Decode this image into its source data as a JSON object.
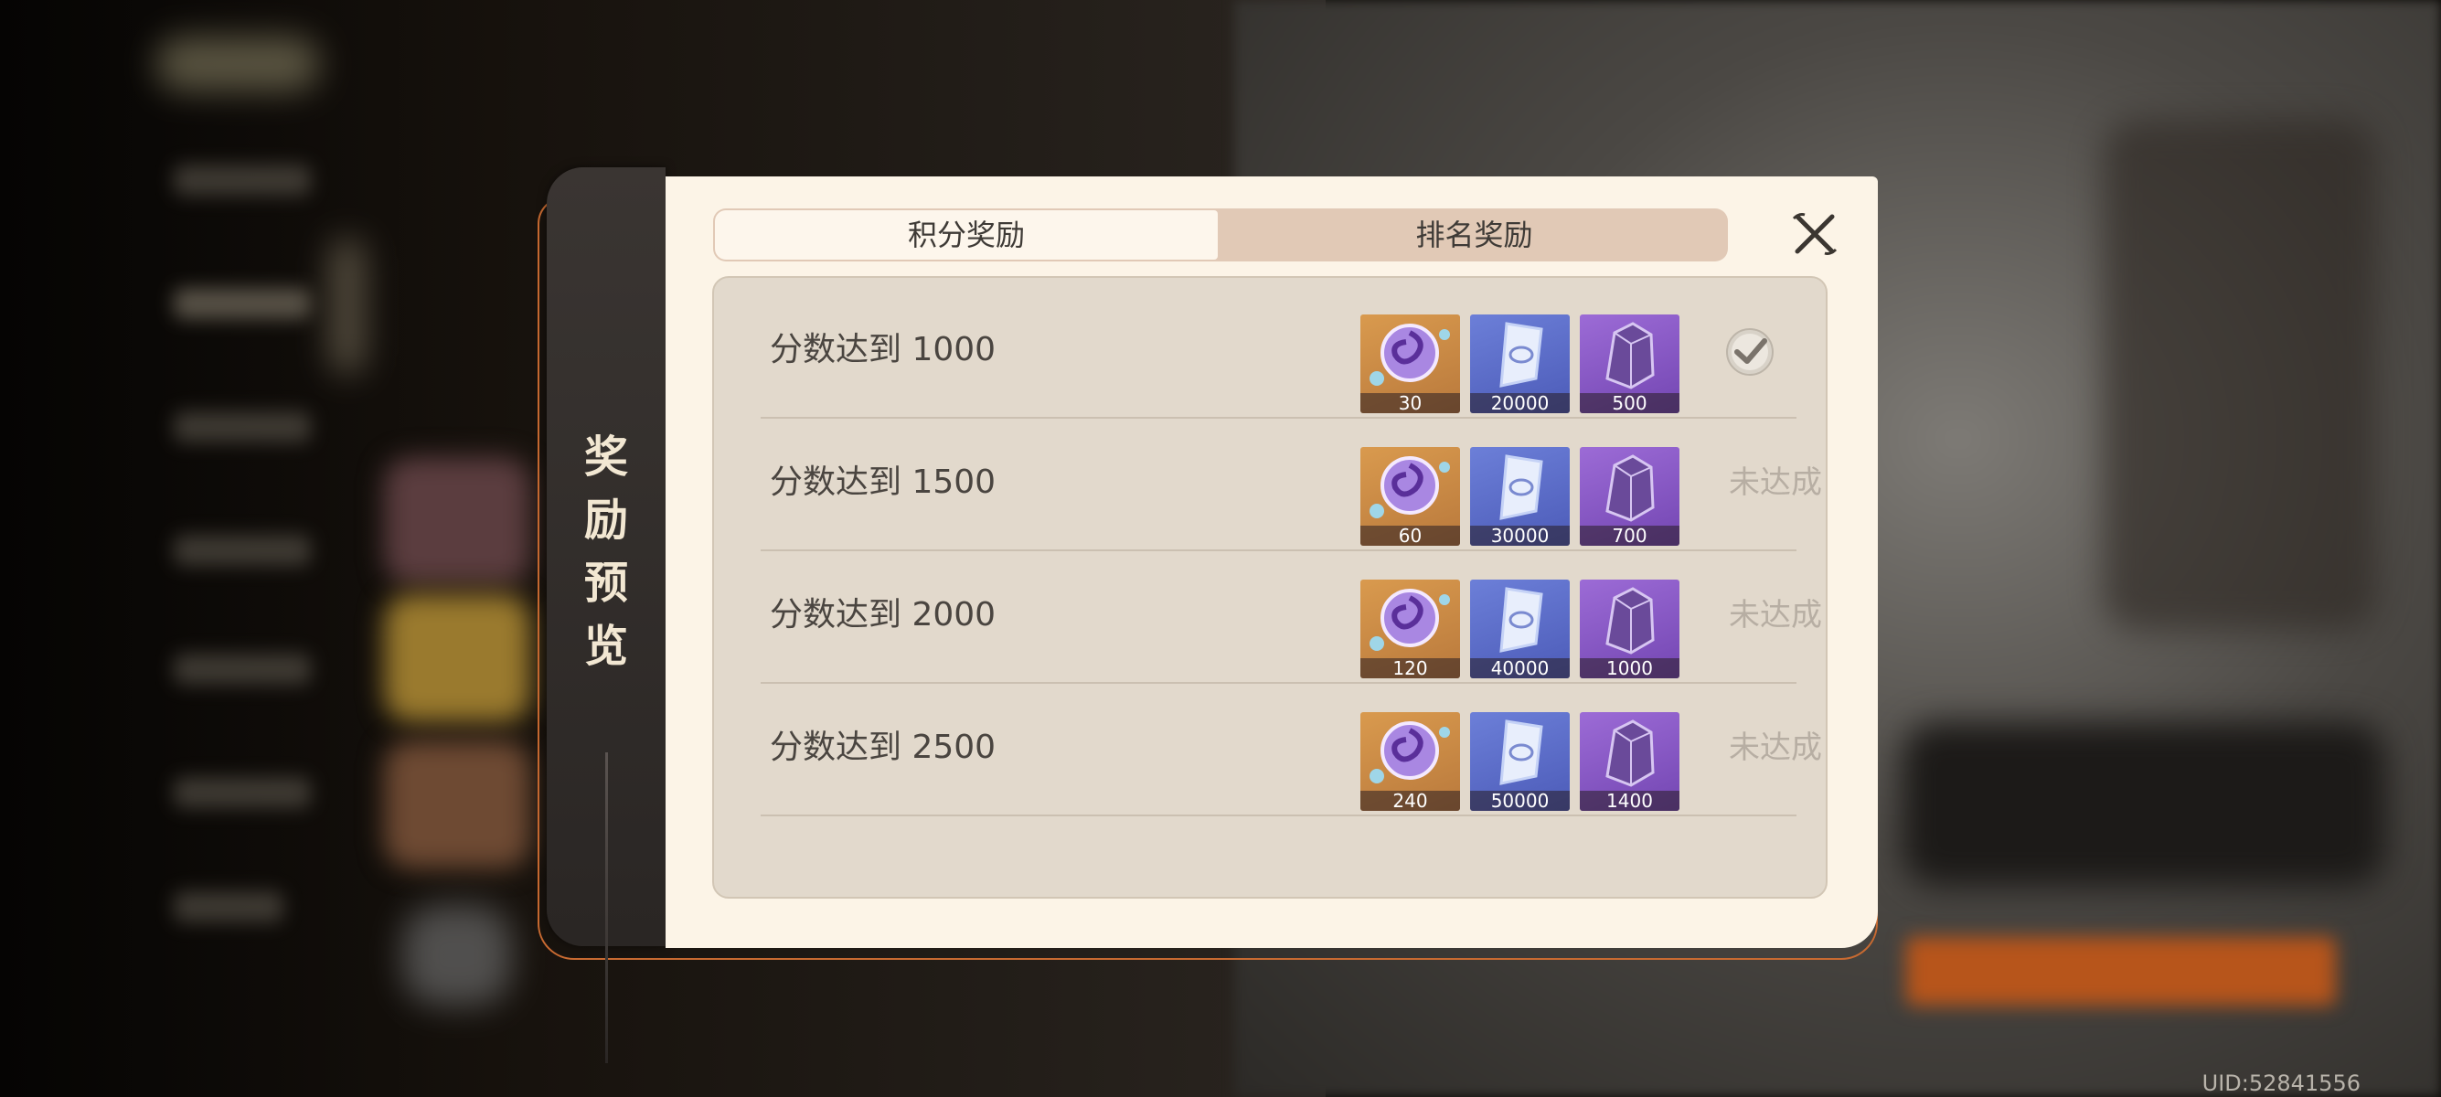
{
  "side_title": [
    "奖",
    "励",
    "预",
    "览"
  ],
  "tabs": {
    "points_reward": "积分奖励",
    "rank_reward": "排名奖励",
    "active": "points_reward"
  },
  "rows": [
    {
      "label": "分数达到 1000",
      "items": [
        {
          "icon": "primogem-swirl-icon",
          "count": "30"
        },
        {
          "icon": "crystal-shard-icon",
          "count": "20000"
        },
        {
          "icon": "purple-ore-icon",
          "count": "500"
        }
      ],
      "status": "claimed",
      "status_icon": "checkmark-icon"
    },
    {
      "label": "分数达到 1500",
      "items": [
        {
          "icon": "primogem-swirl-icon",
          "count": "60"
        },
        {
          "icon": "crystal-shard-icon",
          "count": "30000"
        },
        {
          "icon": "purple-ore-icon",
          "count": "700"
        }
      ],
      "status": "未达成"
    },
    {
      "label": "分数达到 2000",
      "items": [
        {
          "icon": "primogem-swirl-icon",
          "count": "120"
        },
        {
          "icon": "crystal-shard-icon",
          "count": "40000"
        },
        {
          "icon": "purple-ore-icon",
          "count": "1000"
        }
      ],
      "status": "未达成"
    },
    {
      "label": "分数达到 2500",
      "items": [
        {
          "icon": "primogem-swirl-icon",
          "count": "240"
        },
        {
          "icon": "crystal-shard-icon",
          "count": "50000"
        },
        {
          "icon": "purple-ore-icon",
          "count": "1400"
        }
      ],
      "status": "未达成"
    }
  ],
  "uid": "UID:52841556",
  "colors": {
    "accent_orange": "#c86a31",
    "panel_bg": "#fcf4e7",
    "tab_inactive_bg": "#e1c9b6",
    "list_bg": "#e2d9cc",
    "status_muted": "#b7aea3"
  }
}
